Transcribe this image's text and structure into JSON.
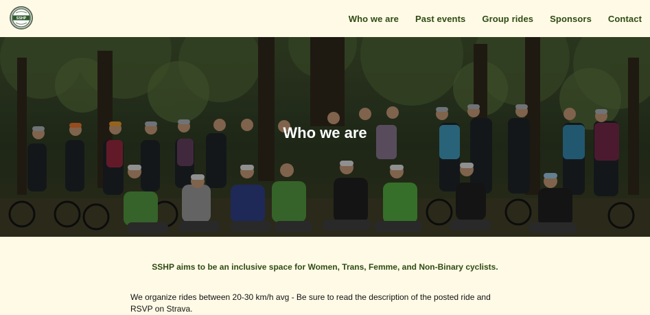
{
  "header": {
    "logo_alt": "SSHP",
    "nav": [
      {
        "label": "Who we are"
      },
      {
        "label": "Past events"
      },
      {
        "label": "Group rides"
      },
      {
        "label": "Sponsors"
      },
      {
        "label": "Contact"
      }
    ]
  },
  "hero": {
    "title": "Who we are"
  },
  "content": {
    "tagline": "SSHP aims to be an inclusive space for Women, Trans, Femme, and Non-Binary cyclists.",
    "body": "We organize rides between 20-30 km/h avg - Be sure to read the description of the posted ride and RSVP on Strava."
  },
  "colors": {
    "accent": "#2f4a14",
    "background": "#fefae6"
  }
}
